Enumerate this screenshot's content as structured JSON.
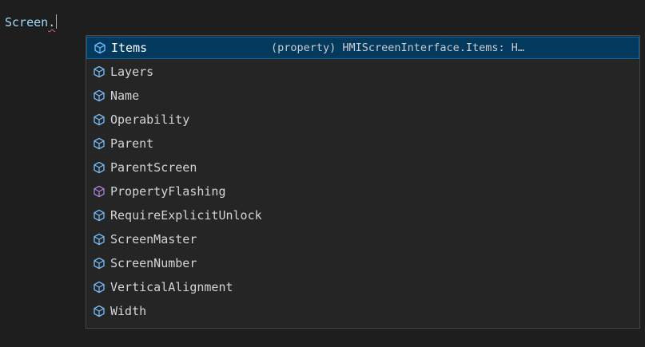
{
  "editor": {
    "typed_text": "Screen",
    "trigger_char": "."
  },
  "suggest": {
    "items": [
      {
        "label": "Items",
        "icon": "property-icon",
        "color": "#75beff",
        "selected": true
      },
      {
        "label": "Layers",
        "icon": "property-icon",
        "color": "#75beff"
      },
      {
        "label": "Name",
        "icon": "property-icon",
        "color": "#75beff"
      },
      {
        "label": "Operability",
        "icon": "property-icon",
        "color": "#75beff"
      },
      {
        "label": "Parent",
        "icon": "property-icon",
        "color": "#75beff"
      },
      {
        "label": "ParentScreen",
        "icon": "property-icon",
        "color": "#75beff"
      },
      {
        "label": "PropertyFlashing",
        "icon": "method-icon",
        "color": "#b180d7"
      },
      {
        "label": "RequireExplicitUnlock",
        "icon": "property-icon",
        "color": "#75beff"
      },
      {
        "label": "ScreenMaster",
        "icon": "property-icon",
        "color": "#75beff"
      },
      {
        "label": "ScreenNumber",
        "icon": "property-icon",
        "color": "#75beff"
      },
      {
        "label": "VerticalAlignment",
        "icon": "property-icon",
        "color": "#75beff"
      },
      {
        "label": "Width",
        "icon": "property-icon",
        "color": "#75beff"
      }
    ],
    "selected_detail": "(property) HMIScreenInterface.Items: H…"
  }
}
